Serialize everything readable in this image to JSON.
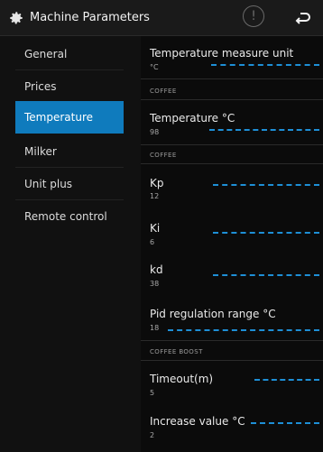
{
  "header": {
    "title": "Machine Parameters",
    "alert_glyph": "!",
    "icons": [
      "gear-icon",
      "alert-icon",
      "back-arrow-icon"
    ]
  },
  "sidebar": {
    "items": [
      {
        "label": "General"
      },
      {
        "label": "Prices"
      },
      {
        "label": "Temperature",
        "active": true
      },
      {
        "label": "Milker"
      },
      {
        "label": "Unit plus"
      },
      {
        "label": "Remote control"
      }
    ]
  },
  "content": {
    "unit": {
      "label": "Temperature measure unit",
      "value": "°C"
    },
    "coffee_section": "COFFEE",
    "temperature": {
      "label": "Temperature °C",
      "value": "98"
    },
    "coffee_section_2": "COFFEE",
    "kp": {
      "label": "Kp",
      "value": "12"
    },
    "ki": {
      "label": "Ki",
      "value": "6"
    },
    "kd": {
      "label": "kd",
      "value": "38"
    },
    "pid_range": {
      "label": "Pid regulation range °C",
      "value": "18"
    },
    "boost_section": "COFFEE BOOST",
    "timeout": {
      "label": "Timeout(m)",
      "value": "5"
    },
    "increase": {
      "label": "Increase value °C",
      "value": "2"
    }
  },
  "colors": {
    "accent": "#0f7bbd",
    "dash": "#1e8fd6",
    "background": "#0b0b0b"
  }
}
